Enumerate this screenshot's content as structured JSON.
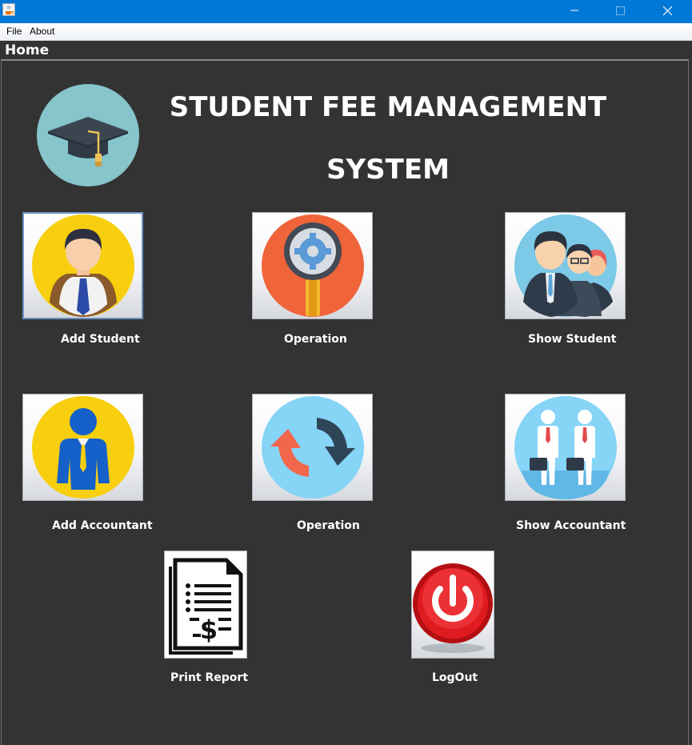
{
  "window": {
    "title": "",
    "controls": {
      "minimize": "minimize-icon",
      "maximize": "maximize-icon",
      "close": "close-icon"
    }
  },
  "menu": {
    "items": [
      "File",
      "About"
    ]
  },
  "tab": {
    "label": "Home"
  },
  "header": {
    "line1": "STUDENT FEE MANAGEMENT",
    "line2": "SYSTEM"
  },
  "tiles": [
    {
      "label": "Add Student",
      "icon": "student-icon"
    },
    {
      "label": "Operation",
      "icon": "magnifier-gear-icon"
    },
    {
      "label": "Show Student",
      "icon": "students-group-icon"
    },
    {
      "label": "Add Accountant",
      "icon": "accountant-icon"
    },
    {
      "label": "Operation",
      "icon": "refresh-arrows-icon"
    },
    {
      "label": "Show Accountant",
      "icon": "accountants-group-icon"
    },
    {
      "label": "Print Report",
      "icon": "invoice-icon"
    },
    {
      "label": "LogOut",
      "icon": "power-icon"
    }
  ],
  "colors": {
    "titlebar": "#0078d7",
    "background": "#333333",
    "text": "#ffffff"
  }
}
